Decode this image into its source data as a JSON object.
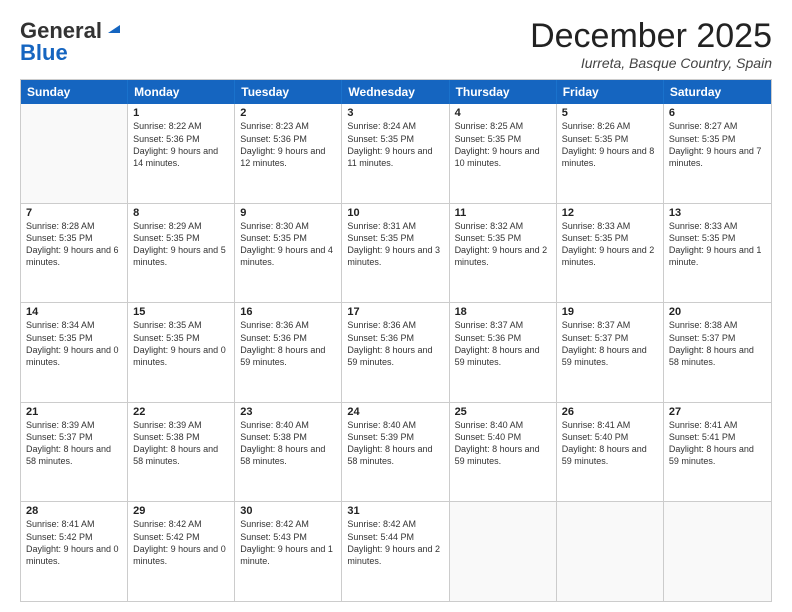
{
  "logo": {
    "general": "General",
    "blue": "Blue"
  },
  "title": "December 2025",
  "location": "Iurreta, Basque Country, Spain",
  "header_days": [
    "Sunday",
    "Monday",
    "Tuesday",
    "Wednesday",
    "Thursday",
    "Friday",
    "Saturday"
  ],
  "weeks": [
    [
      {
        "day": "",
        "sunrise": "",
        "sunset": "",
        "daylight": ""
      },
      {
        "day": "1",
        "sunrise": "Sunrise: 8:22 AM",
        "sunset": "Sunset: 5:36 PM",
        "daylight": "Daylight: 9 hours and 14 minutes."
      },
      {
        "day": "2",
        "sunrise": "Sunrise: 8:23 AM",
        "sunset": "Sunset: 5:36 PM",
        "daylight": "Daylight: 9 hours and 12 minutes."
      },
      {
        "day": "3",
        "sunrise": "Sunrise: 8:24 AM",
        "sunset": "Sunset: 5:35 PM",
        "daylight": "Daylight: 9 hours and 11 minutes."
      },
      {
        "day": "4",
        "sunrise": "Sunrise: 8:25 AM",
        "sunset": "Sunset: 5:35 PM",
        "daylight": "Daylight: 9 hours and 10 minutes."
      },
      {
        "day": "5",
        "sunrise": "Sunrise: 8:26 AM",
        "sunset": "Sunset: 5:35 PM",
        "daylight": "Daylight: 9 hours and 8 minutes."
      },
      {
        "day": "6",
        "sunrise": "Sunrise: 8:27 AM",
        "sunset": "Sunset: 5:35 PM",
        "daylight": "Daylight: 9 hours and 7 minutes."
      }
    ],
    [
      {
        "day": "7",
        "sunrise": "Sunrise: 8:28 AM",
        "sunset": "Sunset: 5:35 PM",
        "daylight": "Daylight: 9 hours and 6 minutes."
      },
      {
        "day": "8",
        "sunrise": "Sunrise: 8:29 AM",
        "sunset": "Sunset: 5:35 PM",
        "daylight": "Daylight: 9 hours and 5 minutes."
      },
      {
        "day": "9",
        "sunrise": "Sunrise: 8:30 AM",
        "sunset": "Sunset: 5:35 PM",
        "daylight": "Daylight: 9 hours and 4 minutes."
      },
      {
        "day": "10",
        "sunrise": "Sunrise: 8:31 AM",
        "sunset": "Sunset: 5:35 PM",
        "daylight": "Daylight: 9 hours and 3 minutes."
      },
      {
        "day": "11",
        "sunrise": "Sunrise: 8:32 AM",
        "sunset": "Sunset: 5:35 PM",
        "daylight": "Daylight: 9 hours and 2 minutes."
      },
      {
        "day": "12",
        "sunrise": "Sunrise: 8:33 AM",
        "sunset": "Sunset: 5:35 PM",
        "daylight": "Daylight: 9 hours and 2 minutes."
      },
      {
        "day": "13",
        "sunrise": "Sunrise: 8:33 AM",
        "sunset": "Sunset: 5:35 PM",
        "daylight": "Daylight: 9 hours and 1 minute."
      }
    ],
    [
      {
        "day": "14",
        "sunrise": "Sunrise: 8:34 AM",
        "sunset": "Sunset: 5:35 PM",
        "daylight": "Daylight: 9 hours and 0 minutes."
      },
      {
        "day": "15",
        "sunrise": "Sunrise: 8:35 AM",
        "sunset": "Sunset: 5:35 PM",
        "daylight": "Daylight: 9 hours and 0 minutes."
      },
      {
        "day": "16",
        "sunrise": "Sunrise: 8:36 AM",
        "sunset": "Sunset: 5:36 PM",
        "daylight": "Daylight: 8 hours and 59 minutes."
      },
      {
        "day": "17",
        "sunrise": "Sunrise: 8:36 AM",
        "sunset": "Sunset: 5:36 PM",
        "daylight": "Daylight: 8 hours and 59 minutes."
      },
      {
        "day": "18",
        "sunrise": "Sunrise: 8:37 AM",
        "sunset": "Sunset: 5:36 PM",
        "daylight": "Daylight: 8 hours and 59 minutes."
      },
      {
        "day": "19",
        "sunrise": "Sunrise: 8:37 AM",
        "sunset": "Sunset: 5:37 PM",
        "daylight": "Daylight: 8 hours and 59 minutes."
      },
      {
        "day": "20",
        "sunrise": "Sunrise: 8:38 AM",
        "sunset": "Sunset: 5:37 PM",
        "daylight": "Daylight: 8 hours and 58 minutes."
      }
    ],
    [
      {
        "day": "21",
        "sunrise": "Sunrise: 8:39 AM",
        "sunset": "Sunset: 5:37 PM",
        "daylight": "Daylight: 8 hours and 58 minutes."
      },
      {
        "day": "22",
        "sunrise": "Sunrise: 8:39 AM",
        "sunset": "Sunset: 5:38 PM",
        "daylight": "Daylight: 8 hours and 58 minutes."
      },
      {
        "day": "23",
        "sunrise": "Sunrise: 8:40 AM",
        "sunset": "Sunset: 5:38 PM",
        "daylight": "Daylight: 8 hours and 58 minutes."
      },
      {
        "day": "24",
        "sunrise": "Sunrise: 8:40 AM",
        "sunset": "Sunset: 5:39 PM",
        "daylight": "Daylight: 8 hours and 58 minutes."
      },
      {
        "day": "25",
        "sunrise": "Sunrise: 8:40 AM",
        "sunset": "Sunset: 5:40 PM",
        "daylight": "Daylight: 8 hours and 59 minutes."
      },
      {
        "day": "26",
        "sunrise": "Sunrise: 8:41 AM",
        "sunset": "Sunset: 5:40 PM",
        "daylight": "Daylight: 8 hours and 59 minutes."
      },
      {
        "day": "27",
        "sunrise": "Sunrise: 8:41 AM",
        "sunset": "Sunset: 5:41 PM",
        "daylight": "Daylight: 8 hours and 59 minutes."
      }
    ],
    [
      {
        "day": "28",
        "sunrise": "Sunrise: 8:41 AM",
        "sunset": "Sunset: 5:42 PM",
        "daylight": "Daylight: 9 hours and 0 minutes."
      },
      {
        "day": "29",
        "sunrise": "Sunrise: 8:42 AM",
        "sunset": "Sunset: 5:42 PM",
        "daylight": "Daylight: 9 hours and 0 minutes."
      },
      {
        "day": "30",
        "sunrise": "Sunrise: 8:42 AM",
        "sunset": "Sunset: 5:43 PM",
        "daylight": "Daylight: 9 hours and 1 minute."
      },
      {
        "day": "31",
        "sunrise": "Sunrise: 8:42 AM",
        "sunset": "Sunset: 5:44 PM",
        "daylight": "Daylight: 9 hours and 2 minutes."
      },
      {
        "day": "",
        "sunrise": "",
        "sunset": "",
        "daylight": ""
      },
      {
        "day": "",
        "sunrise": "",
        "sunset": "",
        "daylight": ""
      },
      {
        "day": "",
        "sunrise": "",
        "sunset": "",
        "daylight": ""
      }
    ]
  ]
}
